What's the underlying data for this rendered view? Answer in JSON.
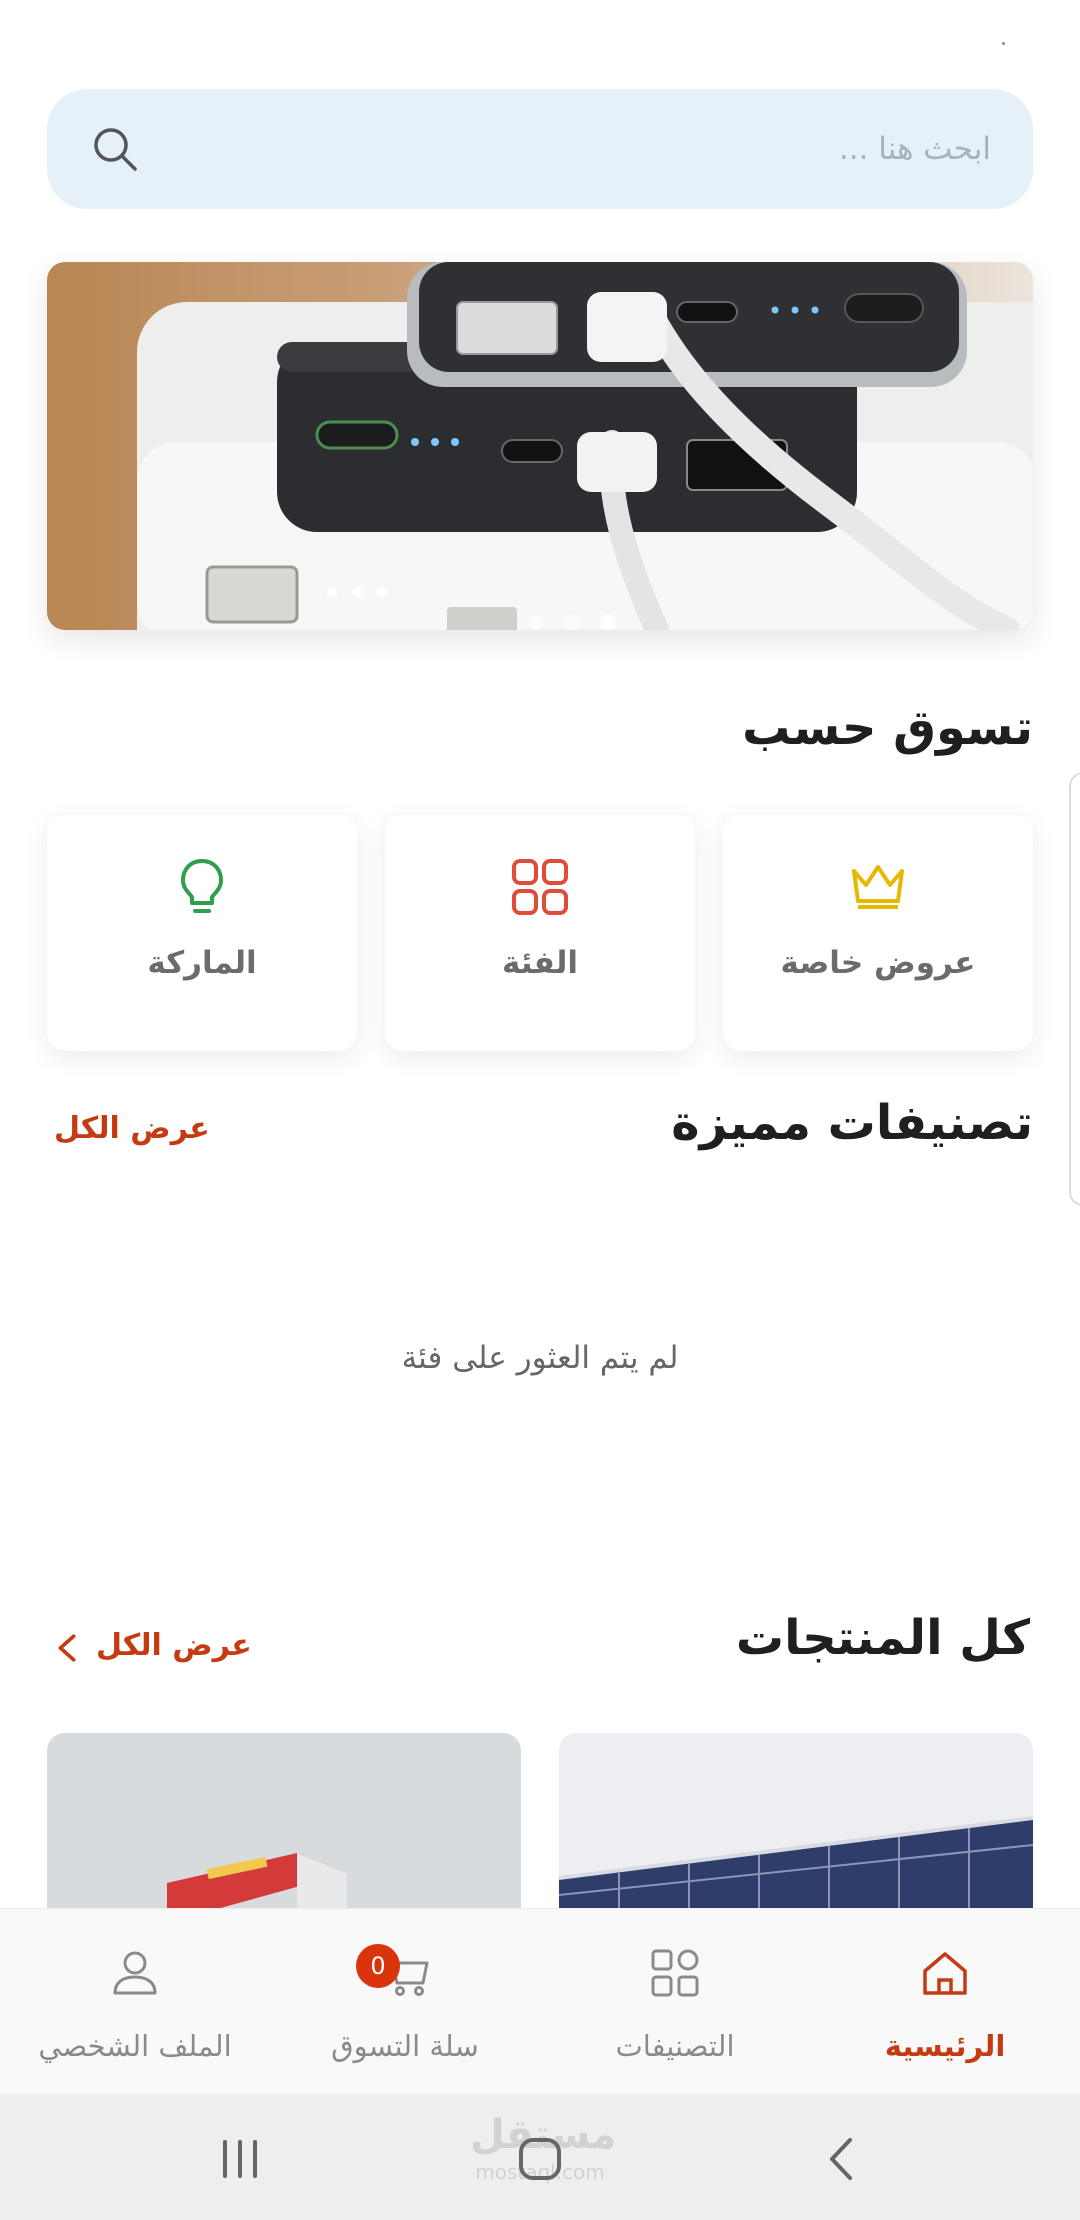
{
  "search": {
    "placeholder": "ابحث هنا ..."
  },
  "banner": {
    "slides": 3,
    "active_slide": 3
  },
  "shop_by": {
    "title": "تسوق حسب",
    "items": [
      {
        "label": "عروض خاصة",
        "icon": "crown-icon",
        "color": "#e6b800"
      },
      {
        "label": "الفئة",
        "icon": "grid-icon",
        "color": "#e04b3a"
      },
      {
        "label": "الماركة",
        "icon": "lightbulb-icon",
        "color": "#2e9e4f"
      }
    ]
  },
  "featured": {
    "title": "تصنيفات مميزة",
    "see_all": "عرض الكل",
    "empty_text": "لم يتم العثور على فئة"
  },
  "all_products": {
    "title": "كل المنتجات",
    "see_all": "عرض الكل"
  },
  "bottom_nav": {
    "items": [
      {
        "label": "الرئيسية",
        "icon": "home-icon",
        "active": true
      },
      {
        "label": "التصنيفات",
        "icon": "categories-icon",
        "active": false
      },
      {
        "label": "سلة التسوق",
        "icon": "cart-icon",
        "active": false,
        "badge": "0"
      },
      {
        "label": "الملف الشخصي",
        "icon": "user-icon",
        "active": false
      }
    ]
  },
  "watermark": {
    "text": "مستقل",
    "domain": "mostaql.com"
  },
  "colors": {
    "accent": "#c63a12",
    "search_bg": "#e5f0f9",
    "badge": "#d9340e"
  }
}
